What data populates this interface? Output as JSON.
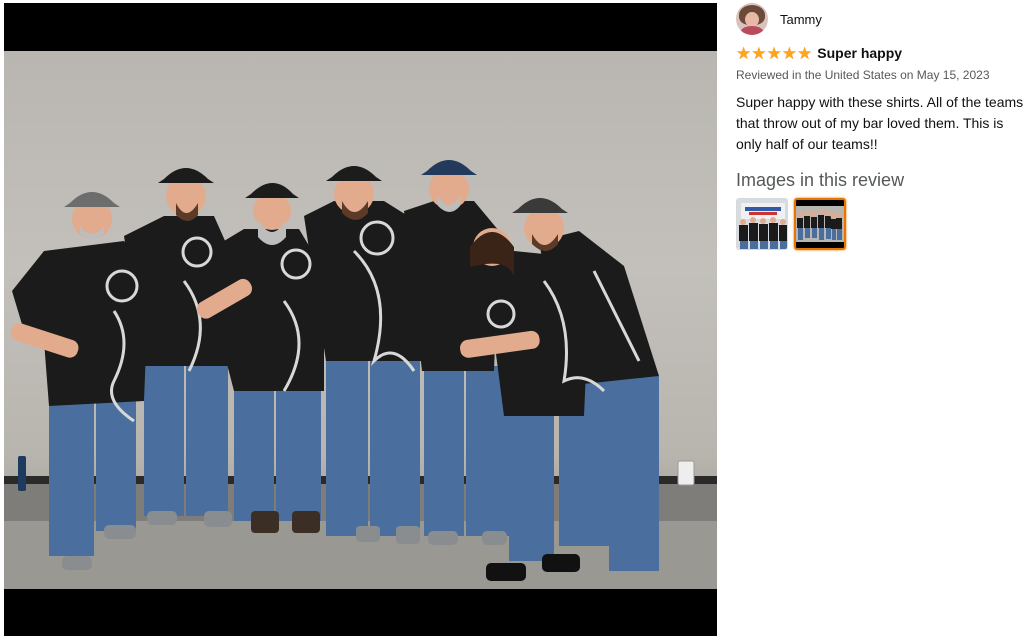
{
  "viewer": {
    "image_alt": "Group photo of seven people in matching black dart shirts"
  },
  "review": {
    "reviewer_name": "Tammy",
    "rating": 5,
    "rating_max": 5,
    "title": "Super happy",
    "date_line": "Reviewed in the United States on May 15, 2023",
    "body": "Super happy with these shirts. All of the teams that throw out of my bar loved them. This is only half of our teams!!",
    "images_heading": "Images in this review",
    "thumbnails": [
      {
        "name": "review-thumbnail-1",
        "selected": false
      },
      {
        "name": "review-thumbnail-2",
        "selected": true
      }
    ]
  },
  "colors": {
    "star": "#ffa41c",
    "selected_border": "#e77600",
    "muted_text": "#565959"
  },
  "icons": {
    "star": "star-icon",
    "avatar": "reviewer-avatar"
  }
}
